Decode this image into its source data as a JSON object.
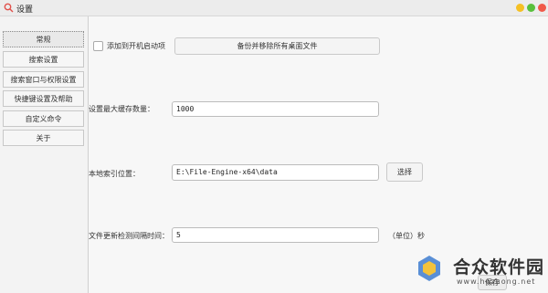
{
  "window": {
    "title": "设置"
  },
  "sidebar": {
    "items": [
      {
        "label": "常规",
        "active": true
      },
      {
        "label": "搜索设置"
      },
      {
        "label": "搜索窗口与权限设置"
      },
      {
        "label": "快捷键设置及帮助"
      },
      {
        "label": "自定义命令"
      },
      {
        "label": "关于"
      }
    ]
  },
  "general": {
    "startup_label": "添加到开机启动项",
    "backup_button": "备份并移除所有桌面文件",
    "cache_label": "设置最大缓存数量：",
    "cache_value": "1000",
    "index_label": "本地索引位置：",
    "index_value": "E:\\File-Engine-x64\\data",
    "choose_button": "选择",
    "interval_label": "文件更新检测间隔时间：",
    "interval_value": "5",
    "interval_unit": "（单位）秒",
    "save_button": "保存"
  },
  "watermark": {
    "main": "合众软件园",
    "sub": "www.hezhong.net"
  },
  "colors": {
    "close": "#f05a4a",
    "minimize": "#f5c024",
    "maximize": "#58c03c"
  }
}
